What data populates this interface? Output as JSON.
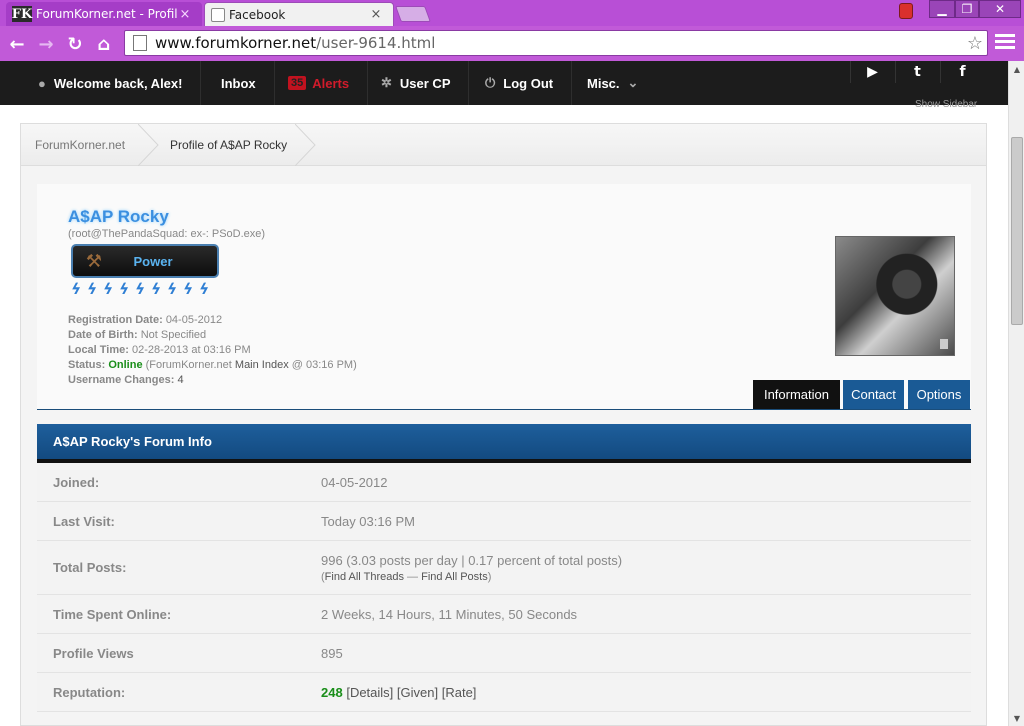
{
  "browser": {
    "tabs": [
      {
        "favicon_text": "FK",
        "title": "ForumKorner.net - Profile",
        "close": "×"
      },
      {
        "favicon_text": "",
        "title": "Facebook",
        "close": "×"
      }
    ],
    "window_controls": {
      "minimize": "▁",
      "maximize": "❐",
      "close": "✕"
    },
    "url_host": "www.forumkorner.net",
    "url_path": "/user-9614.html",
    "star": "☆",
    "nav": {
      "back": "←",
      "forward": "→",
      "reload": "↻",
      "home": "⌂"
    }
  },
  "site_nav": {
    "welcome": "Welcome back, Alex!",
    "inbox": "Inbox",
    "alerts_count": "35",
    "alerts": "Alerts",
    "user_cp": "User CP",
    "log_out": "Log Out",
    "misc": "Misc.",
    "social": {
      "youtube": "▶",
      "twitter": "t",
      "facebook": "f"
    },
    "show_sidebar": "Show Sidebar"
  },
  "breadcrumb": [
    "ForumKorner.net",
    "Profile of A$AP Rocky"
  ],
  "profile": {
    "username": "A$AP Rocky",
    "usertitle": "(root@ThePandaSquad: ex-: PSoD.exe)",
    "rank": "Power",
    "rep_bolts": [
      "ϟ",
      "ϟ",
      "ϟ",
      "ϟ",
      "ϟ",
      "ϟ",
      "ϟ",
      "ϟ",
      "ϟ"
    ],
    "registration_label": "Registration Date:",
    "registration_value": "04-05-2012",
    "dob_label": "Date of Birth:",
    "dob_value": "Not Specified",
    "local_time_label": "Local Time:",
    "local_time_value": "02-28-2013 at 03:16 PM",
    "status_label": "Status:",
    "status_value": "Online",
    "status_detail_a": "(ForumKorner.net",
    "status_detail_b": "Main Index",
    "status_detail_c": "@ 03:16 PM)",
    "username_changes_label": "Username Changes:",
    "username_changes_value": "4"
  },
  "profile_tabs": [
    "Information",
    "Contact",
    "Options"
  ],
  "forum_info": {
    "header": "A$AP Rocky's Forum Info",
    "rows": [
      {
        "label": "Joined:",
        "value": "04-05-2012"
      },
      {
        "label": "Last Visit:",
        "value": "Today 03:16 PM"
      },
      {
        "label": "Total Posts:",
        "value": "996 (3.03 posts per day | 0.17 percent of total posts)",
        "sub_open": "(",
        "sub_link1": "Find All Threads",
        "sub_sep": " — ",
        "sub_link2": "Find All Posts",
        "sub_close": ")"
      },
      {
        "label": "Time Spent Online:",
        "value": "2 Weeks, 14 Hours, 11 Minutes, 50 Seconds"
      },
      {
        "label": "Profile Views",
        "value": "895"
      },
      {
        "label": "Reputation:",
        "rep": "248",
        "details": "[Details]",
        "given": "[Given]",
        "rate": "[Rate]"
      }
    ]
  },
  "colors": {
    "accent": "#1a5a95",
    "online": "#1a8e1a",
    "chrome": "#c15ad8",
    "alerts": "#d11b2b"
  }
}
